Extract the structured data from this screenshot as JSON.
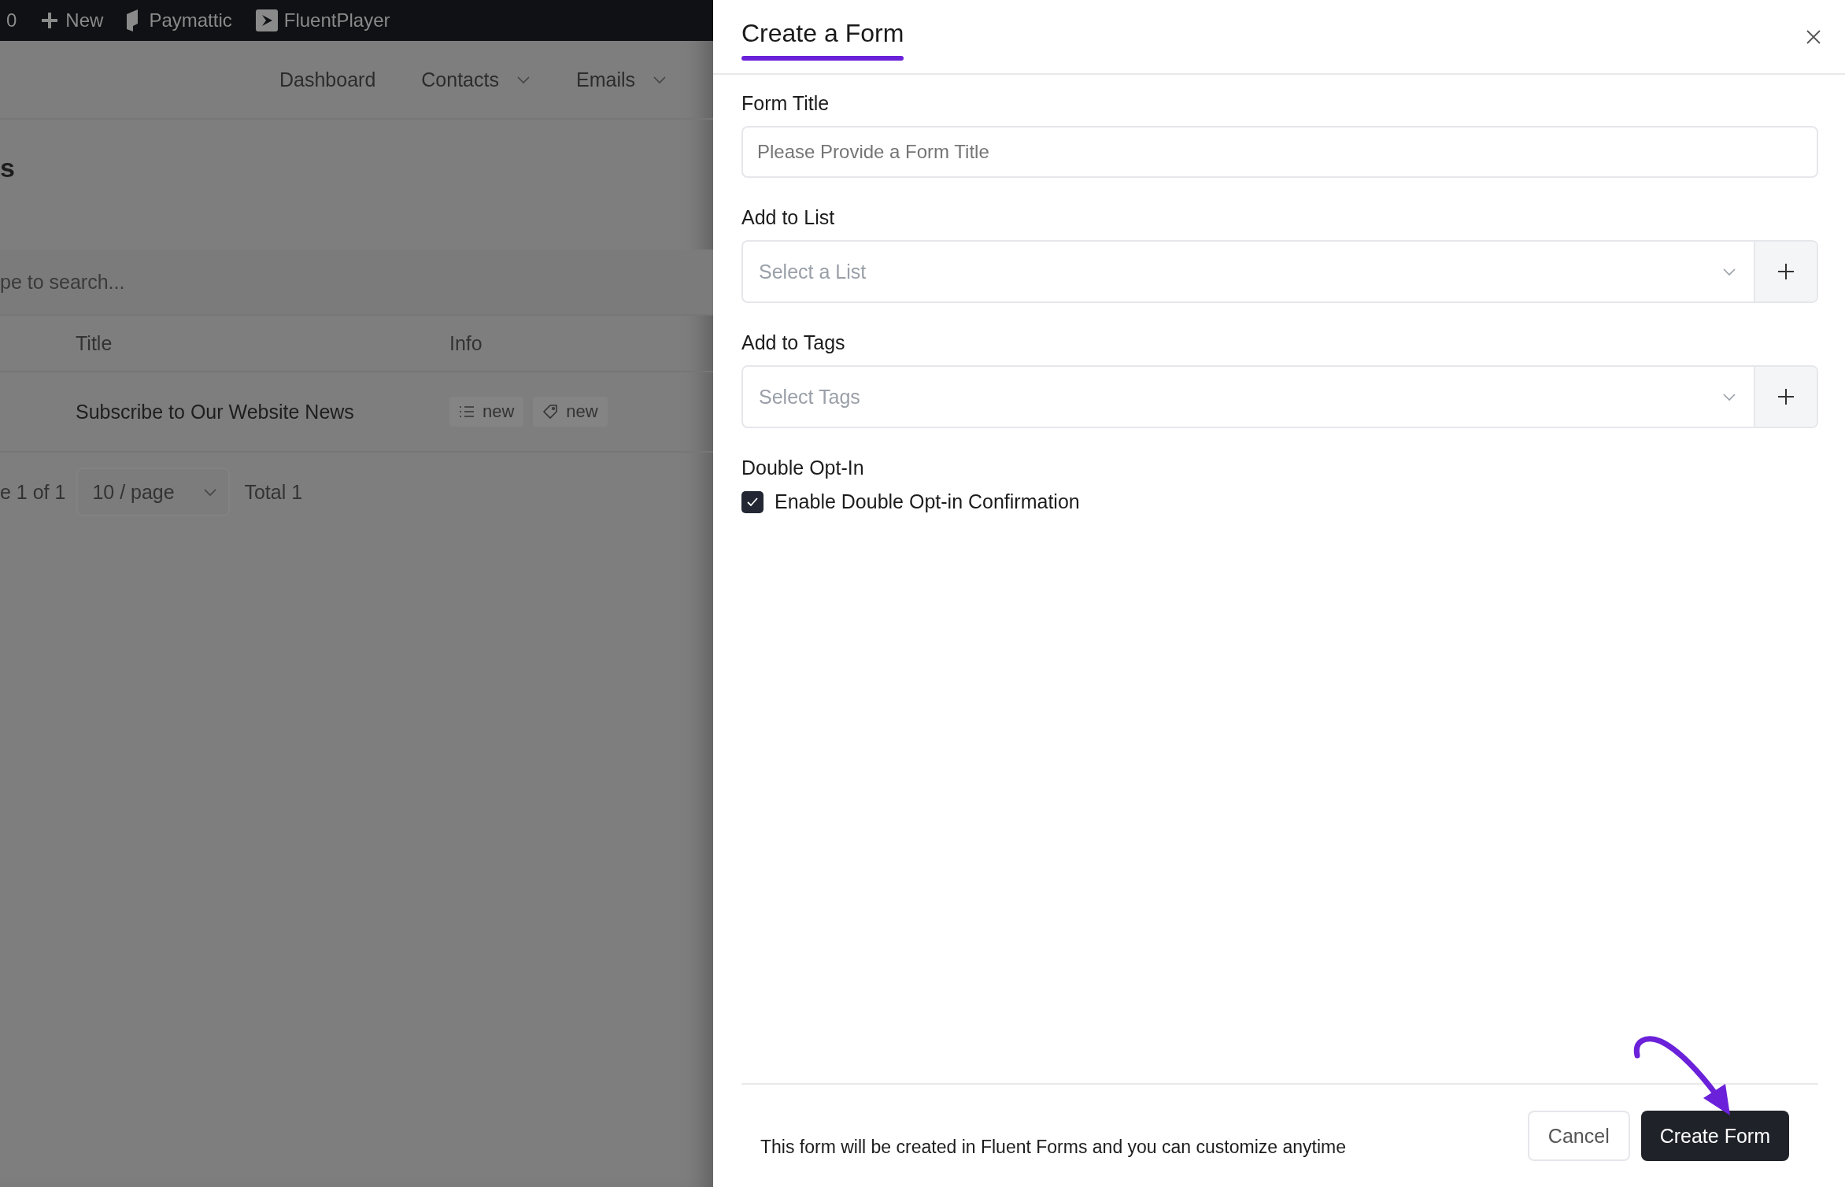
{
  "admin_bar": {
    "items": [
      {
        "kind": "counter",
        "label": "0"
      },
      {
        "kind": "new",
        "label": "New"
      },
      {
        "kind": "paymattic",
        "label": "Paymattic"
      },
      {
        "kind": "player",
        "label": "FluentPlayer"
      }
    ]
  },
  "nav": [
    {
      "label": "Dashboard",
      "dropdown": false
    },
    {
      "label": "Contacts",
      "dropdown": true
    },
    {
      "label": "Emails",
      "dropdown": true
    }
  ],
  "page": {
    "heading": "s",
    "search": {
      "placeholder": "pe to search..."
    },
    "table": {
      "columns": [
        "Title",
        "Info"
      ],
      "rows": [
        {
          "title": "Subscribe to Our Website News",
          "tags": [
            {
              "kind": "list",
              "label": "new"
            },
            {
              "kind": "tag",
              "label": "new"
            }
          ]
        }
      ]
    },
    "pagination": {
      "page_info": "e 1 of 1",
      "page_size": "10 / page",
      "total": "Total 1"
    }
  },
  "drawer": {
    "title": "Create a Form",
    "fields": [
      {
        "kind": "text",
        "label": "Form Title",
        "placeholder": "Please Provide a Form Title"
      },
      {
        "kind": "select",
        "label": "Add to List",
        "placeholder": "Select a List"
      },
      {
        "kind": "select",
        "label": "Add to Tags",
        "placeholder": "Select Tags"
      },
      {
        "kind": "checkbox",
        "label": "Double Opt-In",
        "option": "Enable Double Opt-in Confirmation",
        "checked": true
      }
    ],
    "footer_note": "This form will be created in Fluent Forms and you can customize anytime",
    "buttons": [
      {
        "kind": "secondary",
        "label": "Cancel"
      },
      {
        "kind": "primary",
        "label": "Create Form"
      }
    ]
  }
}
